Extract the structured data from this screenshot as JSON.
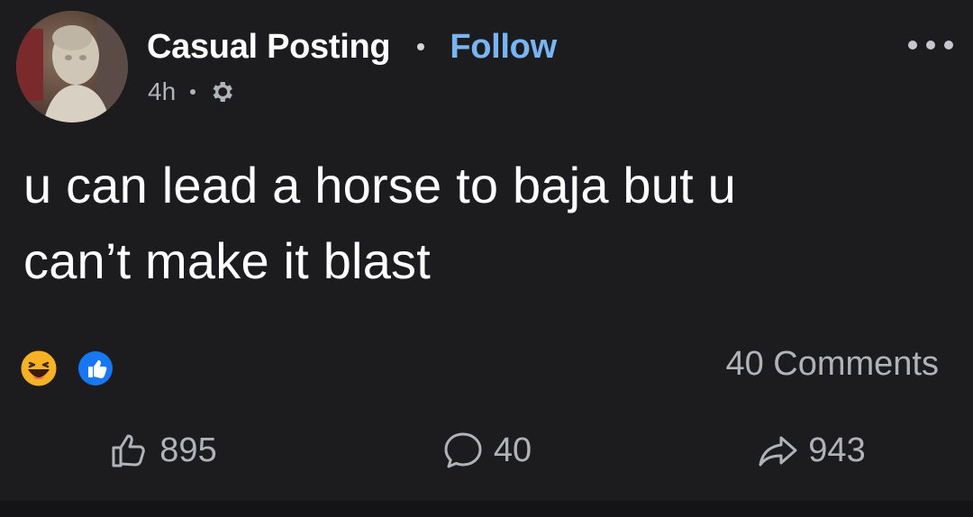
{
  "post": {
    "author": "Casual Posting",
    "follow_label": "Follow",
    "time": "4h",
    "text_line1": "u can lead a horse to baja but u",
    "text_line2": "can’t make it blast"
  },
  "icons": {
    "avatar": "statue-avatar",
    "privacy": "gear-icon",
    "more": "ellipsis-icon",
    "reactions": [
      "haha-icon",
      "like-badge-icon"
    ],
    "actions": [
      "thumbs-up-icon",
      "comment-bubble-icon",
      "share-arrow-icon"
    ]
  },
  "reactions": {
    "comments_label": "40 Comments"
  },
  "actions": {
    "like_count": "895",
    "comment_count": "40",
    "share_count": "943"
  },
  "colors": {
    "background": "#1c1c1e",
    "follow": "#78b5f5",
    "like_badge": "#1877f2",
    "haha": "#f7b125"
  }
}
